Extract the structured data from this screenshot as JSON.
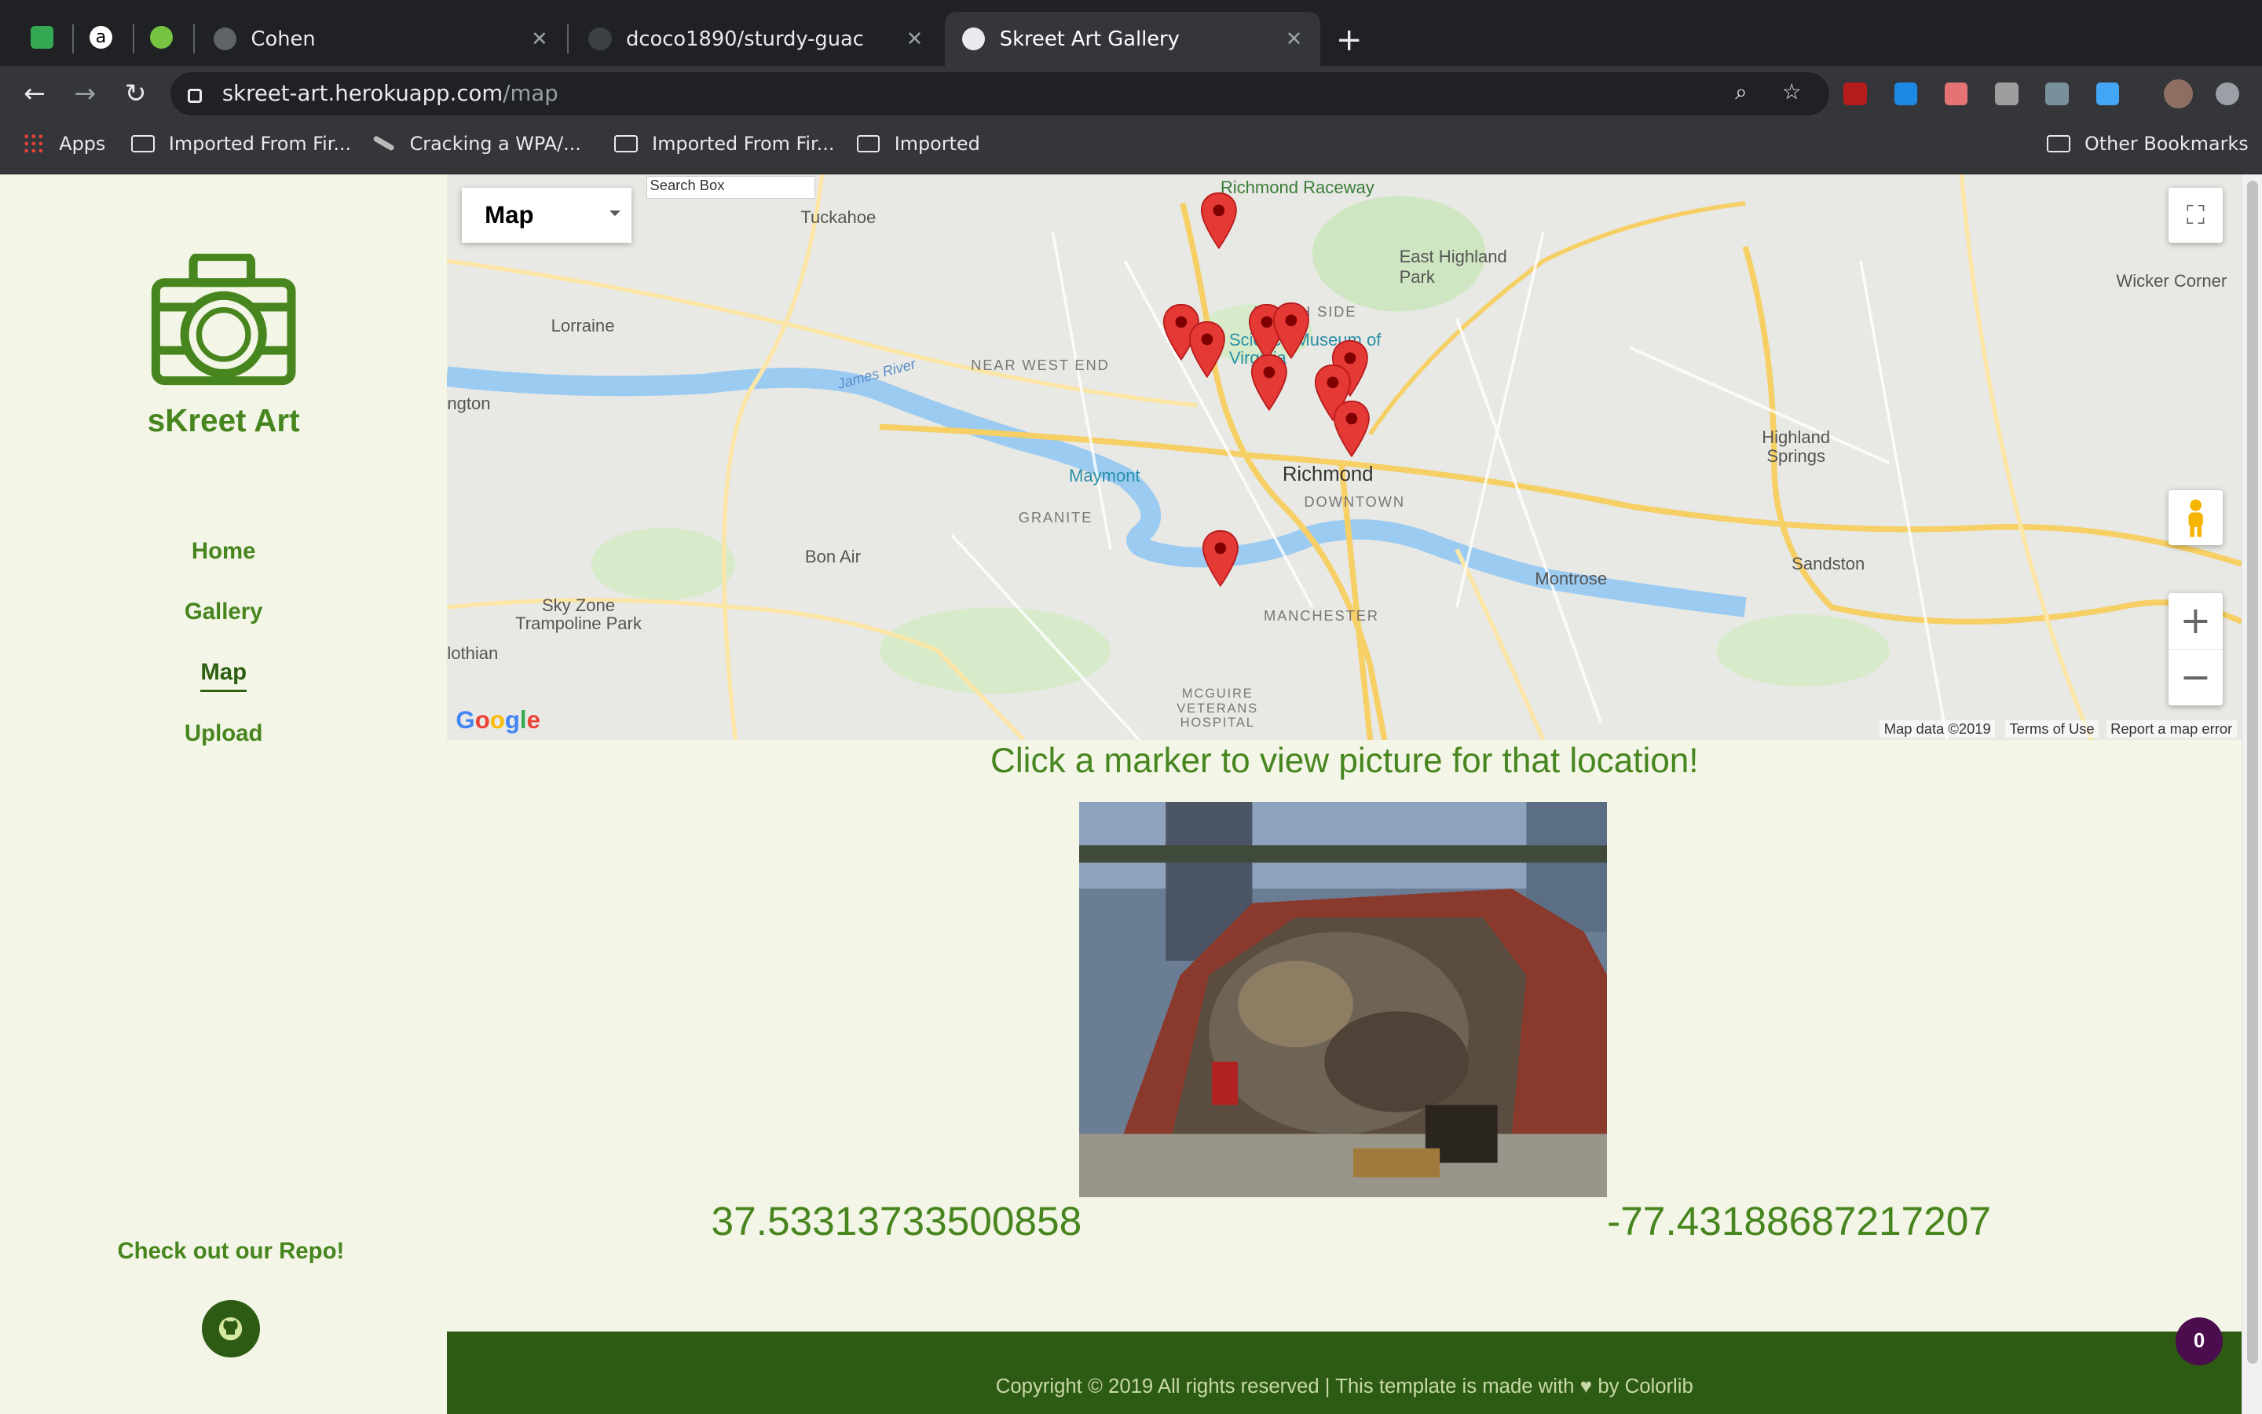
{
  "browser": {
    "tabs": [
      {
        "title": "Cohen"
      },
      {
        "title": "dcoco1890/sturdy-guac"
      },
      {
        "title": "Skreet Art Gallery"
      }
    ],
    "url_host": "skreet-art.herokuapp.com",
    "url_path": "/map",
    "bookmarks": [
      {
        "label": "Apps"
      },
      {
        "label": "Imported From Fir..."
      },
      {
        "label": "Cracking a WPA/..."
      },
      {
        "label": "Imported From Fir..."
      },
      {
        "label": "Imported"
      },
      {
        "label": "Other Bookmarks"
      }
    ]
  },
  "sidebar": {
    "brand": "sKreet Art",
    "menu": [
      "Home",
      "Gallery",
      "Map",
      "Upload"
    ],
    "active_item": "Map",
    "repo_text": "Check out our Repo!"
  },
  "map": {
    "type_label": "Map",
    "search_placeholder": "Search Box",
    "google_logo": "Google",
    "attribution": [
      "Map data ©2019",
      "Terms of Use",
      "Report a map error"
    ],
    "places": [
      "Richmond Raceway",
      "Tuckahoe",
      "East Highland Park",
      "Lorraine",
      "Science Museum of Virginia",
      "NORTH SIDE",
      "NEAR WEST END",
      "James River",
      "Maymont",
      "Richmond",
      "DOWNTOWN",
      "GRANITE",
      "Bon Air",
      "Sky Zone Trampoline Park",
      "MANCHESTER",
      "MCGUIRE VETERANS HOSPITAL",
      "Montrose",
      "Highland Springs",
      "Sandston",
      "Wicker Corner",
      "lothian",
      "ngton"
    ],
    "marker_count": 11
  },
  "main": {
    "headline": "Click a marker to view picture for that location!",
    "latitude": "37.53313733500858",
    "longitude": "-77.43188687217207"
  },
  "footer": {
    "text_before": "Copyright © 2019 All rights reserved | This template is made with",
    "text_after": "by Colorlib"
  },
  "badge_count": "0",
  "colors": {
    "accent_green": "#47851e",
    "footer_green": "#2e5b13",
    "page_bg": "#f3f5e6",
    "marker_red": "#e53935"
  }
}
